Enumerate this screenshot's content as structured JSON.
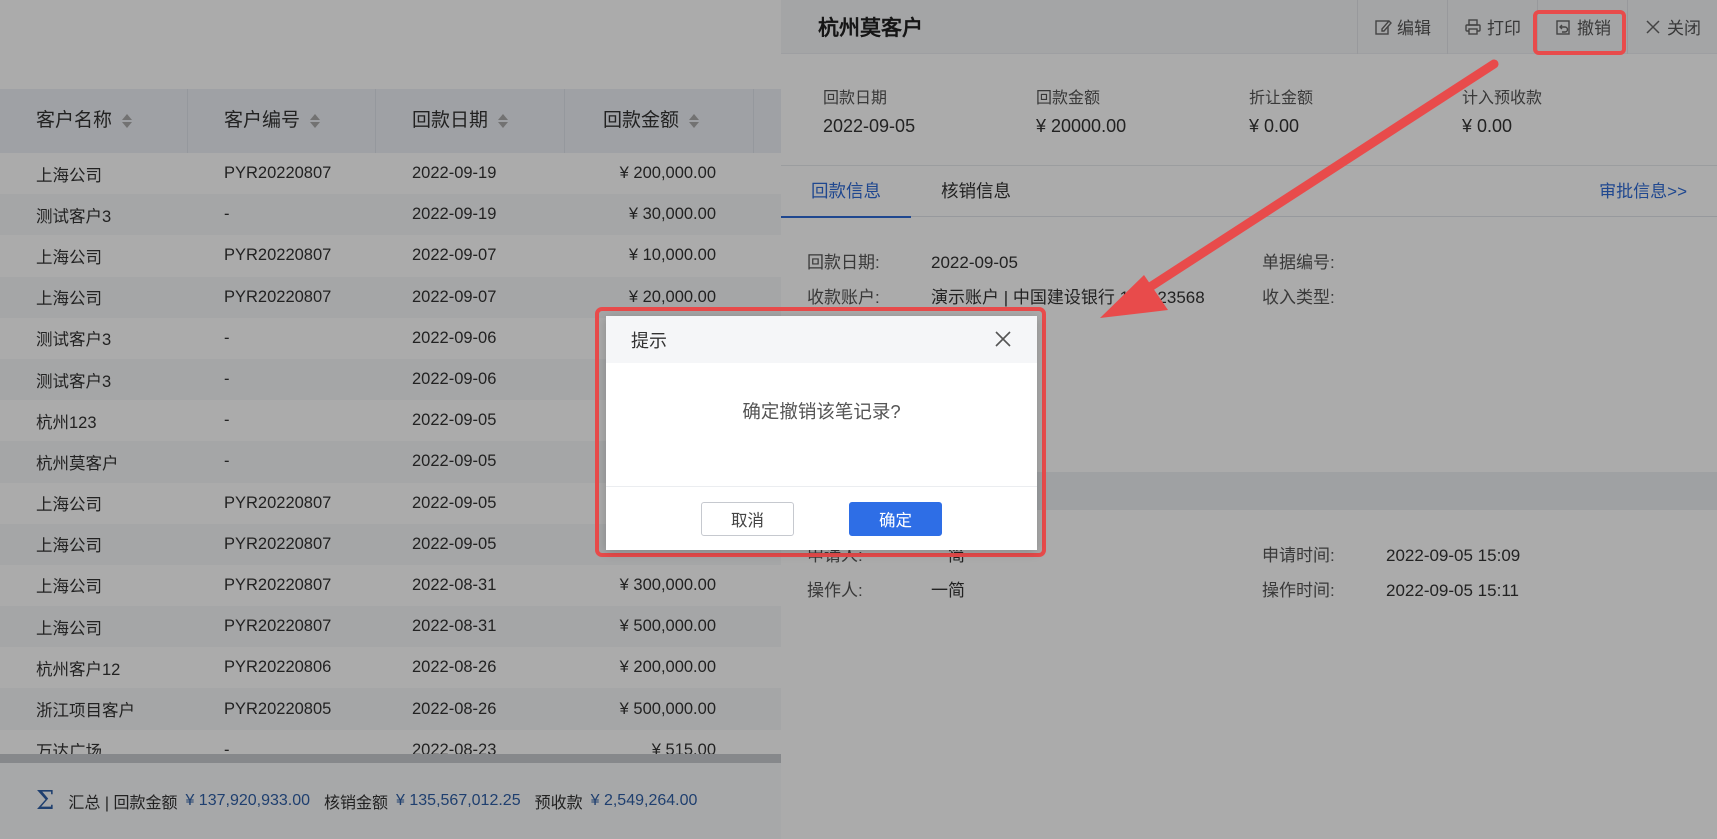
{
  "table": {
    "headers": [
      "客户名称",
      "客户编号",
      "回款日期",
      "回款金额"
    ],
    "rows": [
      {
        "name": "上海公司",
        "code": "PYR20220807",
        "date": "2022-09-19",
        "amount": "¥ 200,000.00"
      },
      {
        "name": "测试客户3",
        "code": "-",
        "date": "2022-09-19",
        "amount": "¥ 30,000.00"
      },
      {
        "name": "上海公司",
        "code": "PYR20220807",
        "date": "2022-09-07",
        "amount": "¥ 10,000.00"
      },
      {
        "name": "上海公司",
        "code": "PYR20220807",
        "date": "2022-09-07",
        "amount": "¥ 20,000.00"
      },
      {
        "name": "测试客户3",
        "code": "-",
        "date": "2022-09-06",
        "amount": ""
      },
      {
        "name": "测试客户3",
        "code": "-",
        "date": "2022-09-06",
        "amount": ""
      },
      {
        "name": "杭州123",
        "code": "-",
        "date": "2022-09-05",
        "amount": ""
      },
      {
        "name": "杭州莫客户",
        "code": "-",
        "date": "2022-09-05",
        "amount": ""
      },
      {
        "name": "上海公司",
        "code": "PYR20220807",
        "date": "2022-09-05",
        "amount": ""
      },
      {
        "name": "上海公司",
        "code": "PYR20220807",
        "date": "2022-09-05",
        "amount": ""
      },
      {
        "name": "上海公司",
        "code": "PYR20220807",
        "date": "2022-08-31",
        "amount": "¥ 300,000.00"
      },
      {
        "name": "上海公司",
        "code": "PYR20220807",
        "date": "2022-08-31",
        "amount": "¥ 500,000.00"
      },
      {
        "name": "杭州客户12",
        "code": "PYR20220806",
        "date": "2022-08-26",
        "amount": "¥ 200,000.00"
      },
      {
        "name": "浙江项目客户",
        "code": "PYR20220805",
        "date": "2022-08-26",
        "amount": "¥ 500,000.00"
      },
      {
        "name": "万达广场",
        "code": "-",
        "date": "2022-08-23",
        "amount": "¥ 515.00"
      }
    ]
  },
  "summary": {
    "sigma": "Σ",
    "prefix": "汇总 | 回款金额",
    "payment_value": "¥ 137,920,933.00",
    "writeoff_label": "核销金额",
    "writeoff_value": "¥ 135,567,012.25",
    "prepay_label": "预收款",
    "prepay_value": "¥ 2,549,264.00"
  },
  "drawer": {
    "title": "杭州莫客户",
    "actions": {
      "edit": "编辑",
      "print": "打印",
      "revoke": "撤销",
      "close": "关闭"
    },
    "stats": [
      {
        "label": "回款日期",
        "value": "2022-09-05"
      },
      {
        "label": "回款金额",
        "value": "¥ 20000.00"
      },
      {
        "label": "折让金额",
        "value": "¥ 0.00"
      },
      {
        "label": "计入预收款",
        "value": "¥ 0.00"
      }
    ],
    "tabs": [
      "回款信息",
      "核销信息"
    ],
    "approve_link": "审批信息>>",
    "fields": {
      "pay_date_label": "回款日期:",
      "pay_date_value": "2022-09-05",
      "doc_no_label": "单据编号:",
      "account_label": "收款账户:",
      "account_value": "演示账户 | 中国建设银行 101223568",
      "income_type_label": "收入类型:",
      "applicant_label": "申请人:",
      "applicant_value": "一简",
      "apply_time_label": "申请时间:",
      "apply_time_value": "2022-09-05 15:09",
      "operator_label": "操作人:",
      "operator_value": "一简",
      "op_time_label": "操作时间:",
      "op_time_value": "2022-09-05 15:11"
    }
  },
  "dialog": {
    "title": "提示",
    "message": "确定撤销该笔记录?",
    "cancel": "取消",
    "ok": "确定"
  },
  "colors": {
    "accent": "#2e6ee6",
    "annotation": "#e84b4b"
  }
}
